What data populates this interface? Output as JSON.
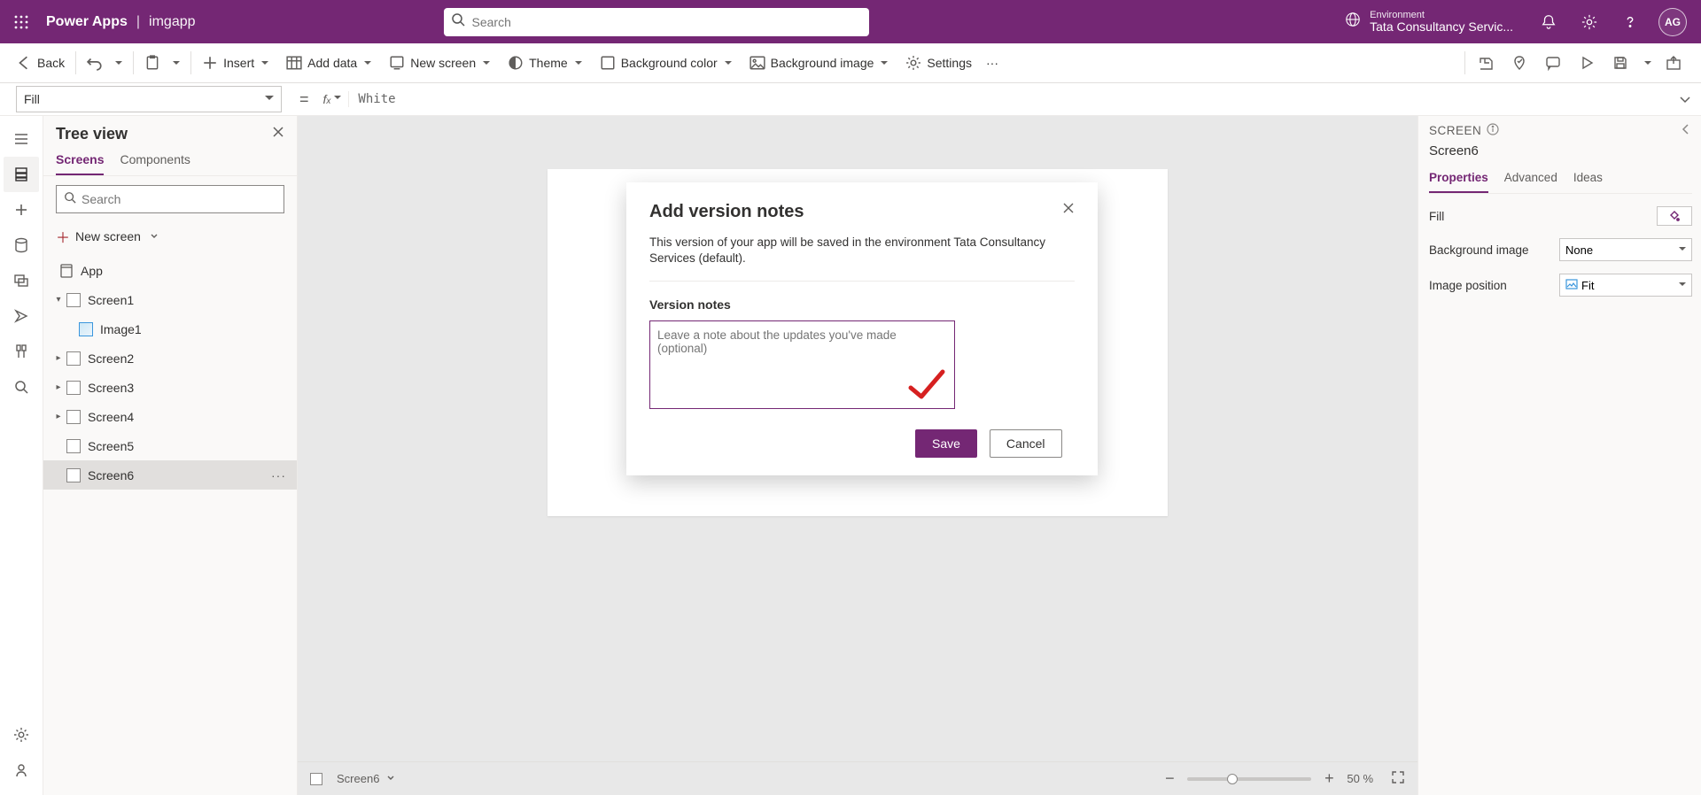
{
  "header": {
    "brand": "Power Apps",
    "separator": "|",
    "app_name": "imgapp",
    "search_placeholder": "Search",
    "environment_label": "Environment",
    "environment_name": "Tata Consultancy Servic...",
    "avatar_initials": "AG"
  },
  "ribbon": {
    "back": "Back",
    "insert": "Insert",
    "add_data": "Add data",
    "new_screen": "New screen",
    "theme": "Theme",
    "background_color": "Background color",
    "background_image": "Background image",
    "settings": "Settings"
  },
  "formula_bar": {
    "property": "Fill",
    "value": "White"
  },
  "tree": {
    "title": "Tree view",
    "tabs": {
      "screens": "Screens",
      "components": "Components"
    },
    "search_placeholder": "Search",
    "new_screen": "New screen",
    "app_label": "App",
    "items": [
      {
        "label": "Screen1",
        "expandable": true,
        "expanded": true,
        "children": [
          {
            "label": "Image1",
            "image": true
          }
        ]
      },
      {
        "label": "Screen2",
        "expandable": true,
        "expanded": false
      },
      {
        "label": "Screen3",
        "expandable": true,
        "expanded": false
      },
      {
        "label": "Screen4",
        "expandable": true,
        "expanded": false
      },
      {
        "label": "Screen5",
        "expandable": false
      },
      {
        "label": "Screen6",
        "expandable": false,
        "selected": true
      }
    ]
  },
  "modal": {
    "title": "Add version notes",
    "description": "This version of your app will be saved in the environment Tata Consultancy Services (default).",
    "field_label": "Version notes",
    "textarea_placeholder": "Leave a note about the updates you've made (optional)",
    "save": "Save",
    "cancel": "Cancel"
  },
  "canvas_footer": {
    "selection": "Screen6",
    "zoom_percent": "50",
    "zoom_suffix": "%"
  },
  "props": {
    "section": "SCREEN",
    "screen_name": "Screen6",
    "tabs": {
      "properties": "Properties",
      "advanced": "Advanced",
      "ideas": "Ideas"
    },
    "fill_label": "Fill",
    "bg_image_label": "Background image",
    "bg_image_value": "None",
    "img_pos_label": "Image position",
    "img_pos_value": "Fit"
  }
}
